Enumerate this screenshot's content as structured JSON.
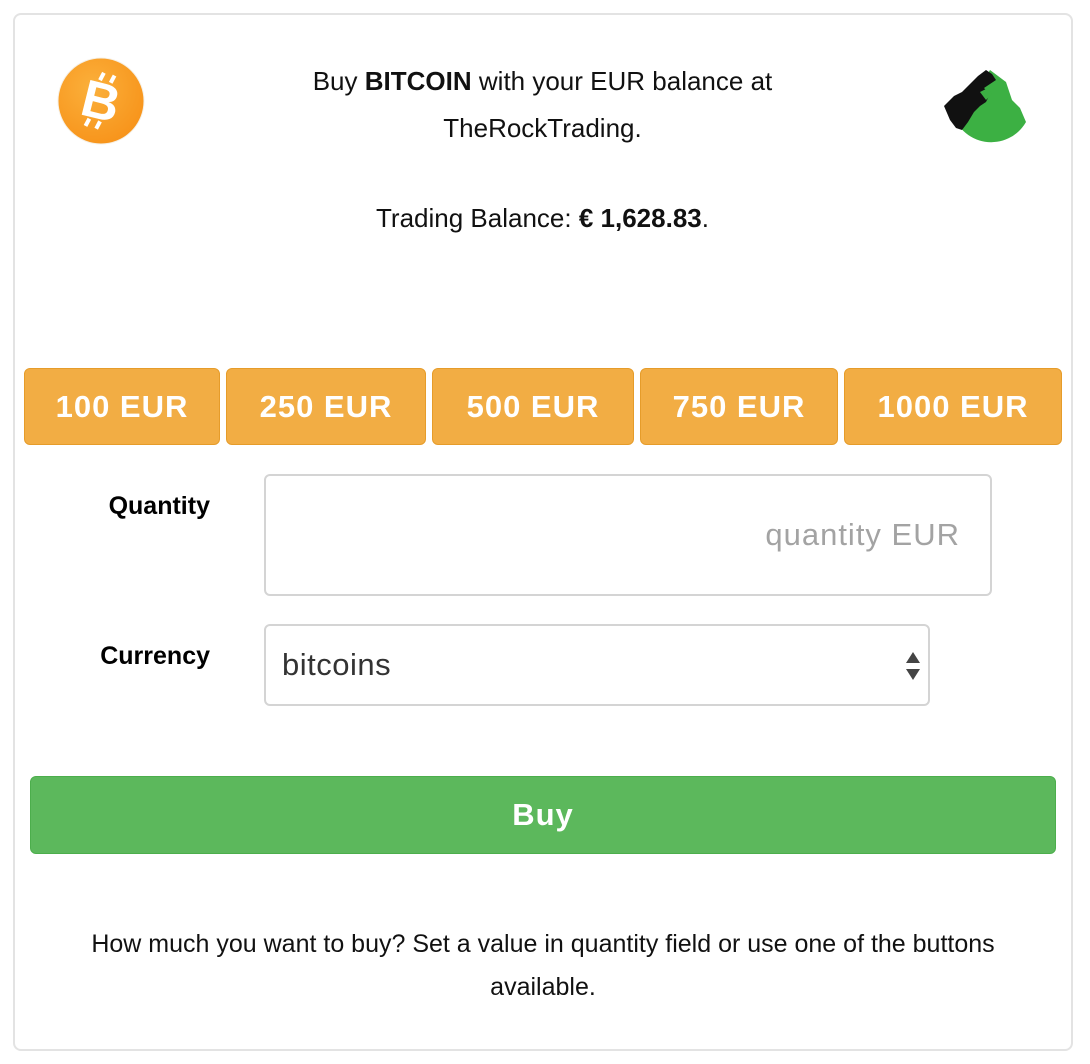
{
  "header": {
    "prefix": "Buy",
    "coin": "BITCOIN",
    "suffix_line1": "with your EUR balance at",
    "exchange": "TheRockTrading."
  },
  "balance": {
    "label": "Trading Balance:",
    "amount": "€ 1,628.83",
    "trailing": "."
  },
  "logos": {
    "left": "bitcoin-logo",
    "right": "therocktrading-logo",
    "bitcoin_color": "#f7931a",
    "rock_color": "#3cb043"
  },
  "amount_buttons": [
    {
      "label": "100 EUR"
    },
    {
      "label": "250 EUR"
    },
    {
      "label": "500 EUR"
    },
    {
      "label": "750 EUR"
    },
    {
      "label": "1000 EUR"
    }
  ],
  "form": {
    "quantity_label": "Quantity",
    "quantity_value": "",
    "quantity_placeholder": "quantity EUR",
    "currency_label": "Currency",
    "currency_selected": "bitcoins"
  },
  "actions": {
    "buy_label": "Buy"
  },
  "help": {
    "text": "How much you want to buy? Set a value in quantity field or use one of the buttons available."
  },
  "colors": {
    "amount_button": "#f2ad44",
    "buy_button": "#5cb85c"
  }
}
